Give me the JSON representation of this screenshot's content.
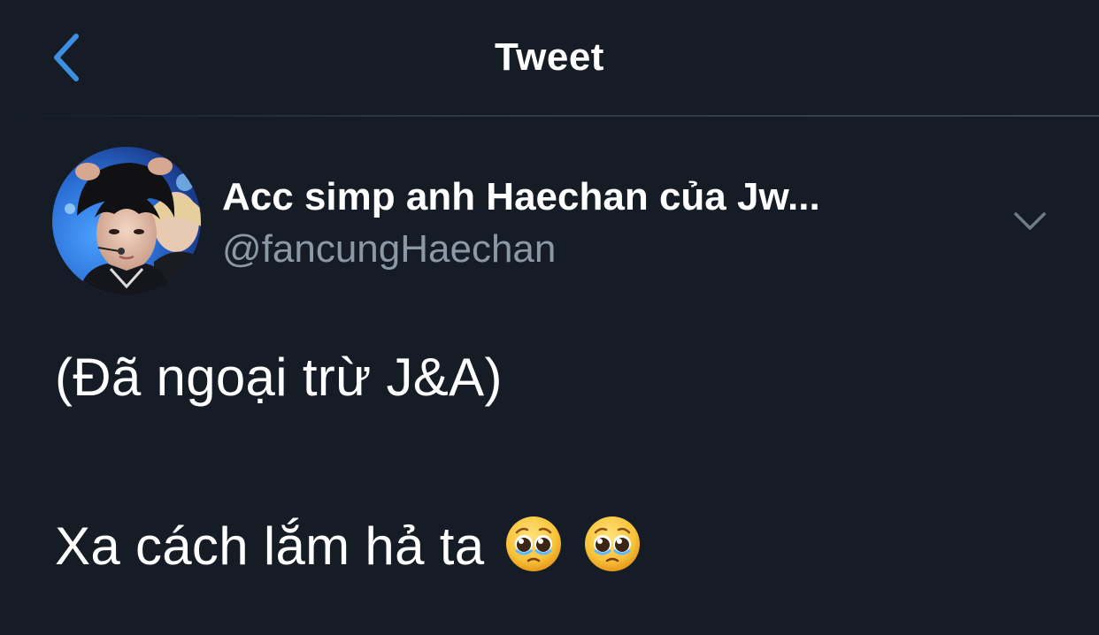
{
  "header": {
    "title": "Tweet",
    "back_icon": "chevron-left-icon"
  },
  "author": {
    "display_name": "Acc simp anh Haechan của Jw...",
    "handle": "@fancungHaechan",
    "menu_icon": "chevron-down-icon"
  },
  "tweet": {
    "line1": "(Đã ngoại trừ J&A)",
    "line2_text": "Xa cách lắm hả ta",
    "emojis": [
      "pleading-face-with-tears",
      "pleading-face-with-tears"
    ]
  },
  "colors": {
    "background": "#151c26",
    "accent": "#1d9bf0",
    "secondary_text": "#8b98a5"
  }
}
